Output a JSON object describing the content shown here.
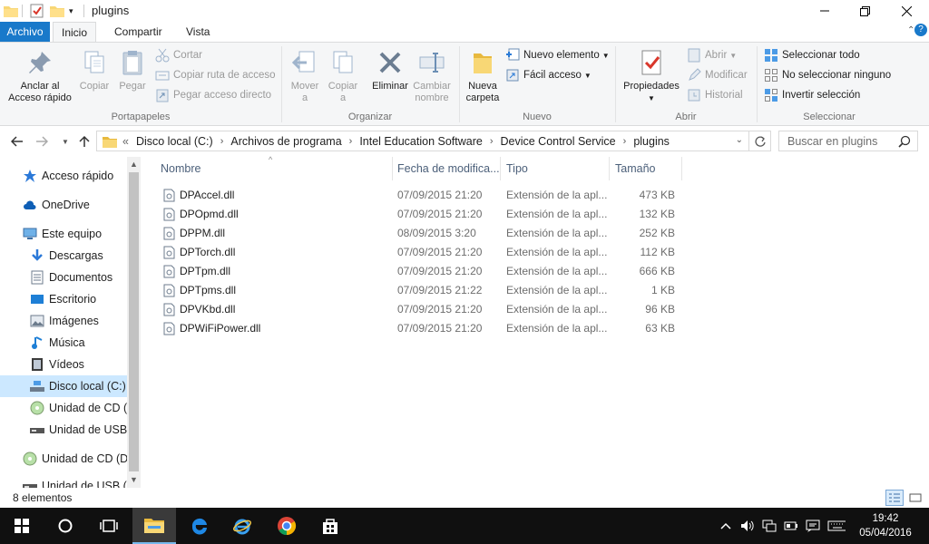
{
  "window": {
    "title": "plugins",
    "minimize": "—",
    "maximize": "❐",
    "close": "✕"
  },
  "tabs": {
    "file": "Archivo",
    "home": "Inicio",
    "share": "Compartir",
    "view": "Vista"
  },
  "ribbon": {
    "clipboard": {
      "label": "Portapapeles",
      "pin": "Anclar al",
      "pin2": "Acceso rápido",
      "copy": "Copiar",
      "paste": "Pegar",
      "cut": "Cortar",
      "copy_path": "Copiar ruta de acceso",
      "paste_shortcut": "Pegar acceso directo"
    },
    "organize": {
      "label": "Organizar",
      "move1": "Mover",
      "move2": "a",
      "copy1": "Copiar",
      "copy2": "a",
      "delete": "Eliminar",
      "rename1": "Cambiar",
      "rename2": "nombre"
    },
    "new": {
      "label": "Nuevo",
      "folder1": "Nueva",
      "folder2": "carpeta",
      "new_item": "Nuevo elemento",
      "easy_access": "Fácil acceso"
    },
    "open": {
      "label": "Abrir",
      "properties": "Propiedades",
      "open": "Abrir",
      "edit": "Modificar",
      "history": "Historial"
    },
    "select": {
      "label": "Seleccionar",
      "select_all": "Seleccionar todo",
      "select_none": "No seleccionar ninguno",
      "invert": "Invertir selección"
    }
  },
  "address": {
    "prefix": "«",
    "crumbs": [
      "Disco local (C:)",
      "Archivos de programa",
      "Intel Education Software",
      "Device Control Service",
      "plugins"
    ],
    "search_placeholder": "Buscar en plugins"
  },
  "sidebar": {
    "items": [
      {
        "label": "Acceso rápido",
        "icon": "star-icon"
      },
      {
        "label": "OneDrive",
        "icon": "cloud-icon"
      },
      {
        "label": "Este equipo",
        "icon": "computer-icon"
      },
      {
        "label": "Descargas",
        "icon": "download-icon"
      },
      {
        "label": "Documentos",
        "icon": "document-icon"
      },
      {
        "label": "Escritorio",
        "icon": "desktop-icon"
      },
      {
        "label": "Imágenes",
        "icon": "pictures-icon"
      },
      {
        "label": "Música",
        "icon": "music-icon"
      },
      {
        "label": "Vídeos",
        "icon": "video-icon"
      },
      {
        "label": "Disco local (C:)",
        "icon": "drive-icon"
      },
      {
        "label": "Unidad de CD (D",
        "icon": "cd-icon"
      },
      {
        "label": "Unidad de USB (",
        "icon": "usb-icon"
      },
      {
        "label": "Unidad de CD (D:)",
        "icon": "cd-icon"
      },
      {
        "label": "Unidad de USB (E:",
        "icon": "usb-icon"
      }
    ]
  },
  "columns": {
    "name": "Nombre",
    "date": "Fecha de modifica...",
    "type": "Tipo",
    "size": "Tamaño"
  },
  "files": [
    {
      "name": "DPAccel.dll",
      "date": "07/09/2015 21:20",
      "type": "Extensión de la apl...",
      "size": "473 KB"
    },
    {
      "name": "DPOpmd.dll",
      "date": "07/09/2015 21:20",
      "type": "Extensión de la apl...",
      "size": "132 KB"
    },
    {
      "name": "DPPM.dll",
      "date": "08/09/2015 3:20",
      "type": "Extensión de la apl...",
      "size": "252 KB"
    },
    {
      "name": "DPTorch.dll",
      "date": "07/09/2015 21:20",
      "type": "Extensión de la apl...",
      "size": "112 KB"
    },
    {
      "name": "DPTpm.dll",
      "date": "07/09/2015 21:20",
      "type": "Extensión de la apl...",
      "size": "666 KB"
    },
    {
      "name": "DPTpms.dll",
      "date": "07/09/2015 21:22",
      "type": "Extensión de la apl...",
      "size": "1 KB"
    },
    {
      "name": "DPVKbd.dll",
      "date": "07/09/2015 21:20",
      "type": "Extensión de la apl...",
      "size": "96 KB"
    },
    {
      "name": "DPWiFiPower.dll",
      "date": "07/09/2015 21:20",
      "type": "Extensión de la apl...",
      "size": "63 KB"
    }
  ],
  "status": {
    "count": "8 elementos"
  },
  "taskbar": {
    "time": "19:42",
    "date": "05/04/2016"
  },
  "colors": {
    "accent": "#1979ca",
    "selection": "#cce8ff",
    "taskbar": "#101010"
  }
}
